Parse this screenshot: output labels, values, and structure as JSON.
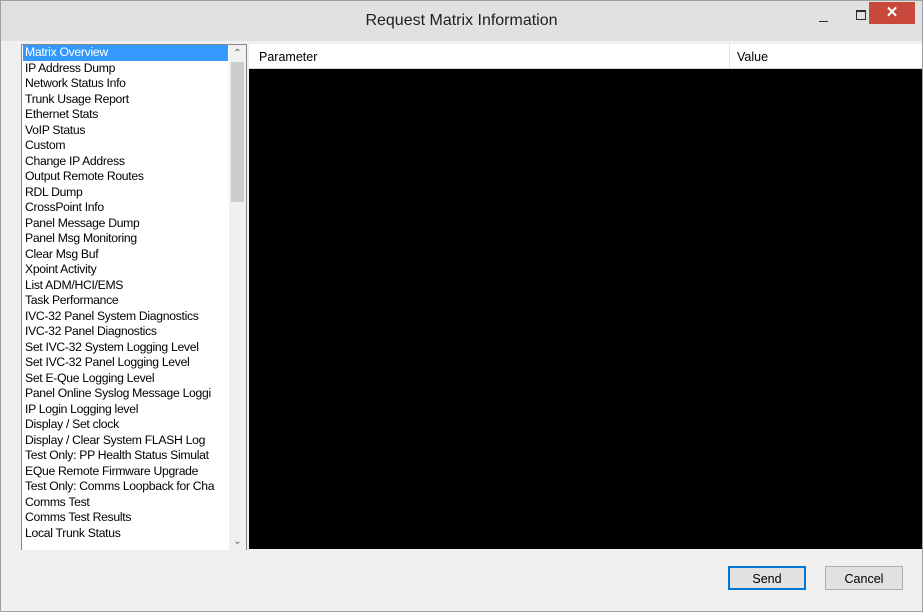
{
  "window": {
    "title": "Request Matrix Information",
    "minimize_glyph": "–",
    "close_glyph": "✕"
  },
  "request_list": {
    "selected_index": 0,
    "items": [
      "Matrix Overview",
      "IP Address Dump",
      "Network Status Info",
      "Trunk Usage Report",
      "Ethernet Stats",
      "VoIP Status",
      "Custom",
      "Change IP Address",
      "Output Remote Routes",
      "RDL Dump",
      "CrossPoint Info",
      "Panel Message Dump",
      "Panel Msg Monitoring",
      "Clear Msg Buf",
      "Xpoint Activity",
      "List ADM/HCI/EMS",
      "Task Performance",
      "IVC-32 Panel System Diagnostics",
      "IVC-32 Panel Diagnostics",
      "Set IVC-32 System Logging Level",
      "Set IVC-32 Panel Logging Level",
      "Set E-Que Logging Level",
      "Panel Online Syslog Message Loggi",
      "IP Login Logging level",
      "Display / Set clock",
      "Display / Clear System FLASH Log",
      "Test Only: PP Health Status Simulat",
      "EQue Remote Firmware Upgrade",
      "Test Only: Comms Loopback for Cha",
      "Comms Test",
      "Comms Test Results",
      "Local Trunk Status"
    ],
    "scroll_up_icon": "chevron-up-icon",
    "scroll_down_icon": "chevron-down-icon"
  },
  "results_grid": {
    "columns": [
      "Parameter",
      "Value"
    ],
    "rows": []
  },
  "buttons": {
    "send": "Send",
    "cancel": "Cancel"
  },
  "colors": {
    "selection": "#3399ff",
    "close_button": "#c9483c",
    "grid_background": "#000000"
  }
}
